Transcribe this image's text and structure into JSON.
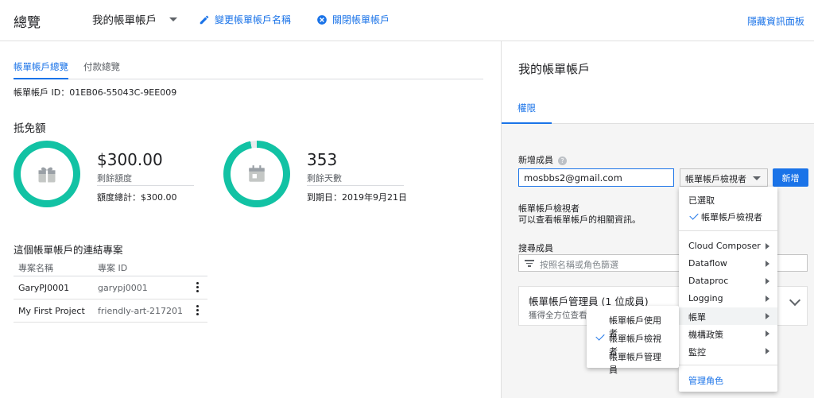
{
  "header": {
    "title": "總覽",
    "account_name": "我的帳單帳戶",
    "rename_label": "變更帳單帳戶名稱",
    "close_label": "關閉帳單帳戶",
    "hide_panel_label": "隱藏資訊面板"
  },
  "tabs": {
    "overview": "帳單帳戶總覽",
    "payment": "付款總覽"
  },
  "account_id": "帳單帳戶 ID：01EB06-55043C-9EE009",
  "credits": {
    "title": "抵免額",
    "amount": {
      "value": "$300.00",
      "label": "剩餘額度",
      "total": "額度總計：$300.00",
      "remaining_fraction": 1.0
    },
    "days": {
      "value": "353",
      "label": "剩餘天數",
      "expiry": "到期日：2019年9月21日",
      "remaining_fraction": 0.97
    }
  },
  "projects": {
    "title": "這個帳單帳戶的連結專案",
    "col_name": "專案名稱",
    "col_id": "專案 ID",
    "rows": [
      {
        "name": "GaryPJ0001",
        "id": "garypj0001"
      },
      {
        "name": "My First Project",
        "id": "friendly-art-217201"
      }
    ]
  },
  "panel": {
    "title": "我的帳單帳戶",
    "tab_permissions": "權限",
    "add_member_label": "新增成員",
    "email_value": "mosbbs2@gmail.com",
    "role_selected": "帳單帳戶檢視者",
    "add_button": "新增",
    "role_desc_title": "帳單帳戶檢視者",
    "role_desc_text": "可以查看帳單帳戶的相關資訊。",
    "search_label": "搜尋成員",
    "search_placeholder": "按照名稱或角色篩選",
    "admin_card_title": "帳單帳戶管理員 (1 位成員)",
    "admin_card_sub": "獲得全方位查看"
  },
  "role_menu": {
    "selected_header": "已選取",
    "selected_item": "帳單帳戶檢視者",
    "items": [
      "Cloud Composer",
      "Dataflow",
      "Dataproc",
      "Logging",
      "帳單",
      "機構政策",
      "監控"
    ],
    "manage_roles": "管理角色"
  },
  "billing_submenu": {
    "items": [
      "帳單帳戶使用者",
      "帳單帳戶檢視者",
      "帳單帳戶管理員"
    ],
    "checked_index": 1
  },
  "colors": {
    "accent": "#1a73e8",
    "ring": "#12c2a4"
  }
}
